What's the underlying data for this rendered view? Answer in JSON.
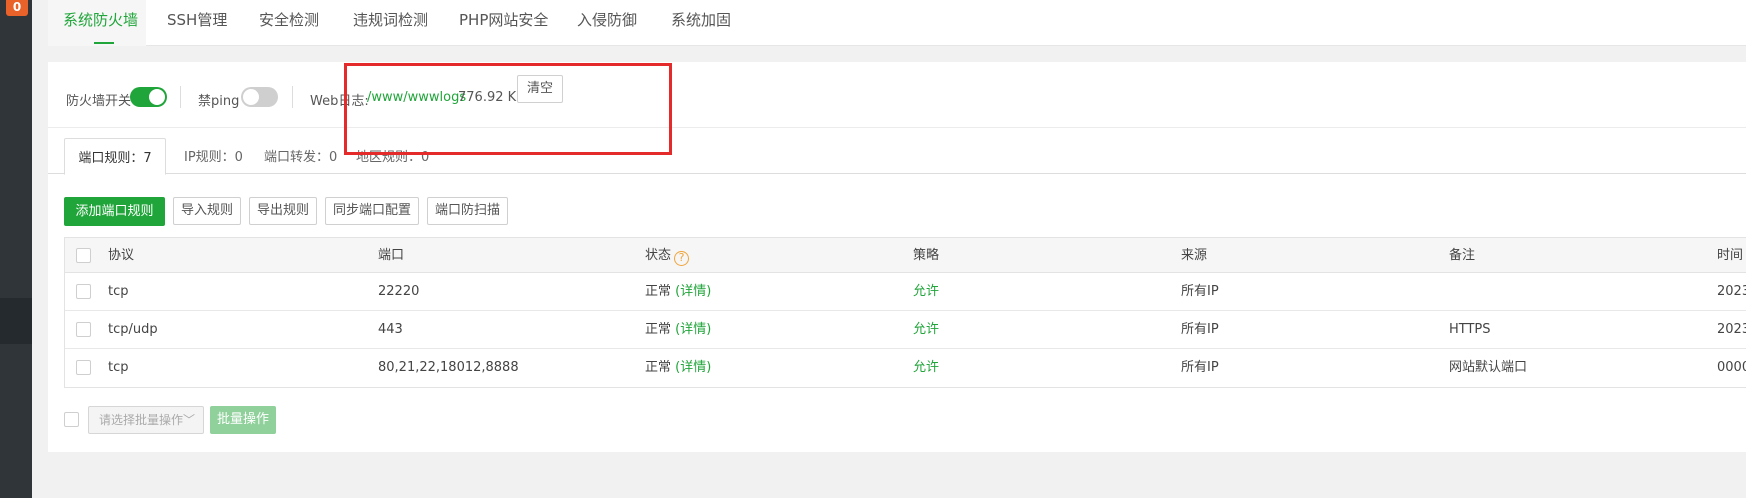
{
  "left_bar": {
    "badge": "0"
  },
  "nav_tabs": [
    {
      "label": "系统防火墙",
      "active": true
    },
    {
      "label": "SSH管理"
    },
    {
      "label": "安全检测"
    },
    {
      "label": "违规词检测"
    },
    {
      "label": "PHP网站安全"
    },
    {
      "label": "入侵防御"
    },
    {
      "label": "系统加固"
    }
  ],
  "toggles": {
    "firewall_label": "防火墙开关",
    "firewall_on": true,
    "ping_label": "禁ping",
    "ping_on": false
  },
  "web_log": {
    "label": "Web日志:",
    "path": "/www/wwwlogs",
    "size": "776.92 KB",
    "clear_button": "清空"
  },
  "sub_tabs": [
    {
      "label": "端口规则：7",
      "active": true
    },
    {
      "label": "IP规则：0"
    },
    {
      "label": "端口转发：0"
    },
    {
      "label": "地区规则：0"
    }
  ],
  "actions": {
    "add": "添加端口规则",
    "import": "导入规则",
    "export": "导出规则",
    "sync": "同步端口配置",
    "scan": "端口防扫描"
  },
  "table": {
    "headers": {
      "protocol": "协议",
      "port": "端口",
      "status": "状态",
      "policy": "策略",
      "source": "来源",
      "remark": "备注",
      "time": "时间"
    },
    "rows": [
      {
        "protocol": "tcp",
        "port": "22220",
        "status": "正常",
        "detail": "(详情)",
        "policy": "允许",
        "source": "所有IP",
        "remark": "",
        "time": "2023"
      },
      {
        "protocol": "tcp/udp",
        "port": "443",
        "status": "正常",
        "detail": "(详情)",
        "policy": "允许",
        "source": "所有IP",
        "remark": "HTTPS",
        "time": "2023"
      },
      {
        "protocol": "tcp",
        "port": "80,21,22,18012,8888",
        "status": "正常",
        "detail": "(详情)",
        "policy": "允许",
        "source": "所有IP",
        "remark": "网站默认端口",
        "time": "0000"
      }
    ]
  },
  "bottom": {
    "select_placeholder": "请选择批量操作",
    "batch_button": "批量操作"
  },
  "colors": {
    "accent": "#20a53a",
    "highlight_box": "#e42a2a",
    "sidebar": "#2f3539"
  }
}
